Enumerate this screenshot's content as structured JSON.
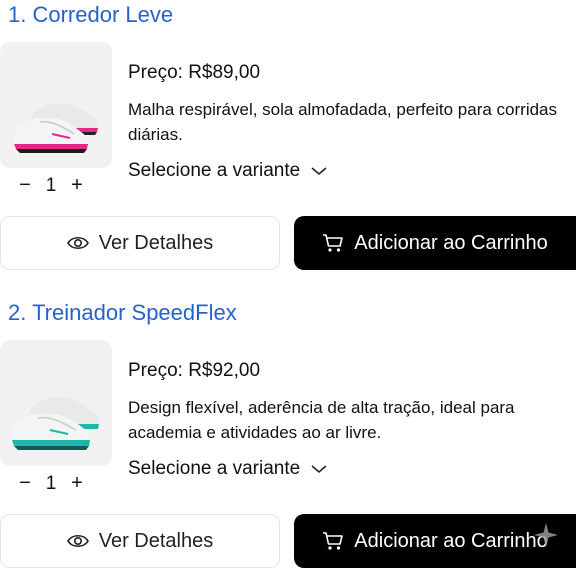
{
  "products": [
    {
      "title": "1. Corredor Leve",
      "price": "Preço: R$89,00",
      "description": "Malha respirável, sola almofadada, perfeito para corridas diárias.",
      "variant_label": "Selecione a variante",
      "quantity": "1",
      "minus": "−",
      "plus": "+",
      "details_label": "Ver Detalhes",
      "cart_label": "Adicionar ao Carrinho",
      "image_icon": "pink-white-running-shoe-image"
    },
    {
      "title": "2. Treinador SpeedFlex",
      "price": "Preço: R$92,00",
      "description": "Design flexível, aderência de alta tração, ideal para academia e atividades ao ar livre.",
      "variant_label": "Selecione a variante",
      "quantity": "1",
      "minus": "−",
      "plus": "+",
      "details_label": "Ver Detalhes",
      "cart_label": "Adicionar ao Carrinho",
      "image_icon": "teal-white-running-shoe-image"
    }
  ],
  "colors": {
    "title_blue": "#2563c9",
    "button_dark": "#000000",
    "thumb_bg": "#f1f1f1",
    "shoe1_accent": "#e8268a",
    "shoe2_accent": "#1fb5a8"
  }
}
